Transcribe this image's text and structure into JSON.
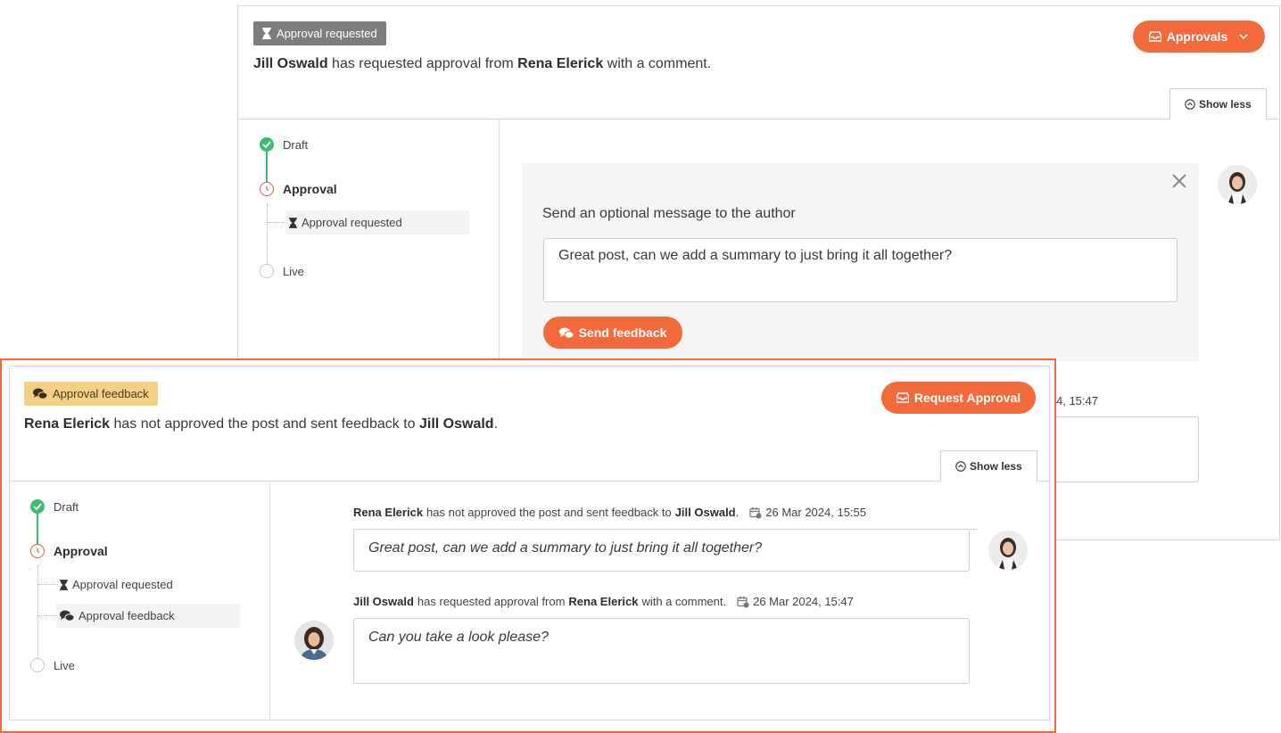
{
  "back": {
    "status_badge": "Approval requested",
    "headline": {
      "actor": "Jill Oswald",
      "mid": " has requested approval from ",
      "target": "Rena Elerick",
      "end": " with a comment."
    },
    "approvals_button": "Approvals",
    "show_less": "Show less",
    "steps": {
      "draft": "Draft",
      "approval": "Approval",
      "sub1": "Approval requested",
      "live": "Live"
    },
    "feedback_prompt": "Send an optional message to the author",
    "feedback_text": "Great post, can we add a summary to just bring it all together?",
    "send_button": "Send feedback",
    "peek_time": "4, 15:47"
  },
  "front": {
    "status_badge": "Approval feedback",
    "headline": {
      "actor": "Rena Elerick",
      "mid": " has not approved the post and sent feedback to ",
      "target": "Jill Oswald",
      "end": "."
    },
    "request_button": "Request Approval",
    "show_less": "Show less",
    "steps": {
      "draft": "Draft",
      "approval": "Approval",
      "sub1": "Approval requested",
      "sub2": "Approval feedback",
      "live": "Live"
    },
    "messages": [
      {
        "actor": "Rena Elerick",
        "mid": "has not approved the post and sent feedback to",
        "target": "Jill Oswald",
        "end": ".",
        "time": "26 Mar 2024, 15:55",
        "text": "Great post, can we add a summary to just bring it all together?"
      },
      {
        "actor": "Jill Oswald",
        "mid": "has requested approval from",
        "target": "Rena Elerick",
        "end": "with a comment.",
        "time": "26 Mar 2024, 15:47",
        "text": "Can you take a look please?"
      }
    ]
  },
  "colors": {
    "accent": "#f26a3c",
    "success": "#3bbf6e",
    "active": "#e2584a",
    "badge_grey": "#7d7d7d",
    "badge_yellow": "#f4cf86"
  },
  "icons": [
    "hourglass-icon",
    "inbox-icon",
    "chevron-down-icon",
    "chevron-up-circle-icon",
    "check-icon",
    "clock-icon",
    "chat-bubbles-icon",
    "close-icon",
    "calendar-clock-icon"
  ]
}
